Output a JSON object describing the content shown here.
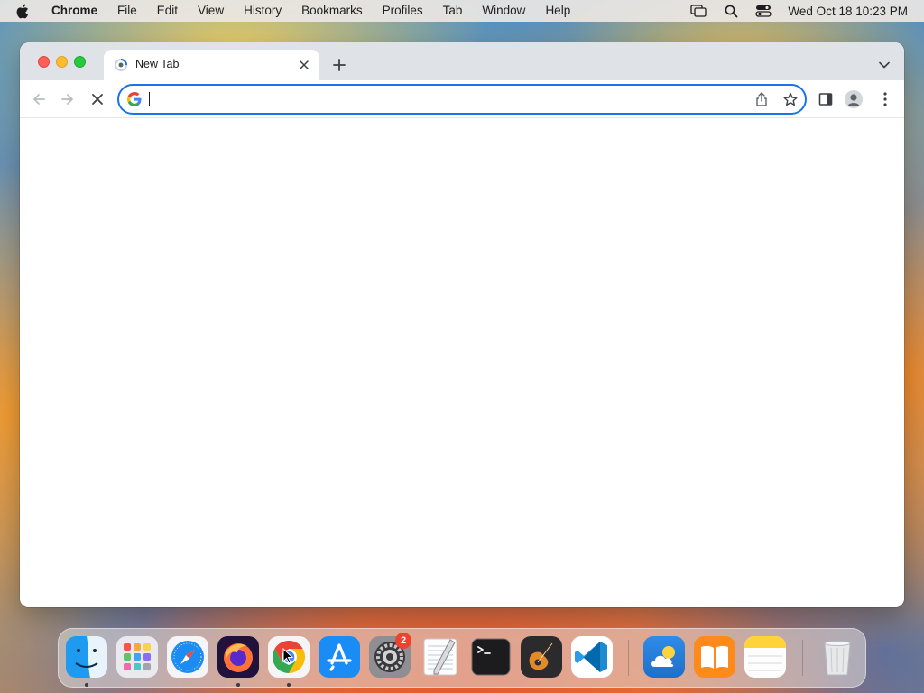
{
  "menubar": {
    "app_name": "Chrome",
    "items": [
      "File",
      "Edit",
      "View",
      "History",
      "Bookmarks",
      "Profiles",
      "Tab",
      "Window",
      "Help"
    ],
    "clock": "Wed Oct 18  10:23 PM",
    "status_icons": [
      "screen-mirroring-icon",
      "spotlight-search-icon",
      "control-center-icon"
    ]
  },
  "browser": {
    "tab": {
      "title": "New Tab"
    },
    "omnibox": {
      "value": "",
      "placeholder": ""
    },
    "toolbar_buttons": [
      "back",
      "forward",
      "stop-loading",
      "share",
      "bookmark-star",
      "side-panel",
      "profile",
      "more-menu"
    ],
    "accent_color": "#1a73e8"
  },
  "dock": {
    "apps": [
      {
        "name": "Finder",
        "icon": "finder-icon",
        "running": true
      },
      {
        "name": "Launchpad",
        "icon": "launchpad-icon",
        "running": false
      },
      {
        "name": "Safari",
        "icon": "safari-icon",
        "running": false
      },
      {
        "name": "Firefox",
        "icon": "firefox-icon",
        "running": true
      },
      {
        "name": "Google Chrome",
        "icon": "chrome-icon",
        "running": true
      },
      {
        "name": "App Store",
        "icon": "app-store-icon",
        "running": false
      },
      {
        "name": "System Settings",
        "icon": "system-settings-icon",
        "running": false,
        "badge": "2"
      },
      {
        "name": "TextEdit",
        "icon": "textedit-icon",
        "running": false
      },
      {
        "name": "Terminal",
        "icon": "terminal-icon",
        "running": false
      },
      {
        "name": "GarageBand",
        "icon": "garageband-icon",
        "running": false
      },
      {
        "name": "Visual Studio Code",
        "icon": "vscode-icon",
        "running": false
      },
      {
        "name": "Weather",
        "icon": "weather-icon",
        "running": false
      },
      {
        "name": "Books",
        "icon": "books-icon",
        "running": false
      },
      {
        "name": "Notes",
        "icon": "notes-icon",
        "running": false
      },
      {
        "name": "Trash",
        "icon": "trash-icon",
        "running": false
      }
    ],
    "system_settings_badge": "2"
  }
}
